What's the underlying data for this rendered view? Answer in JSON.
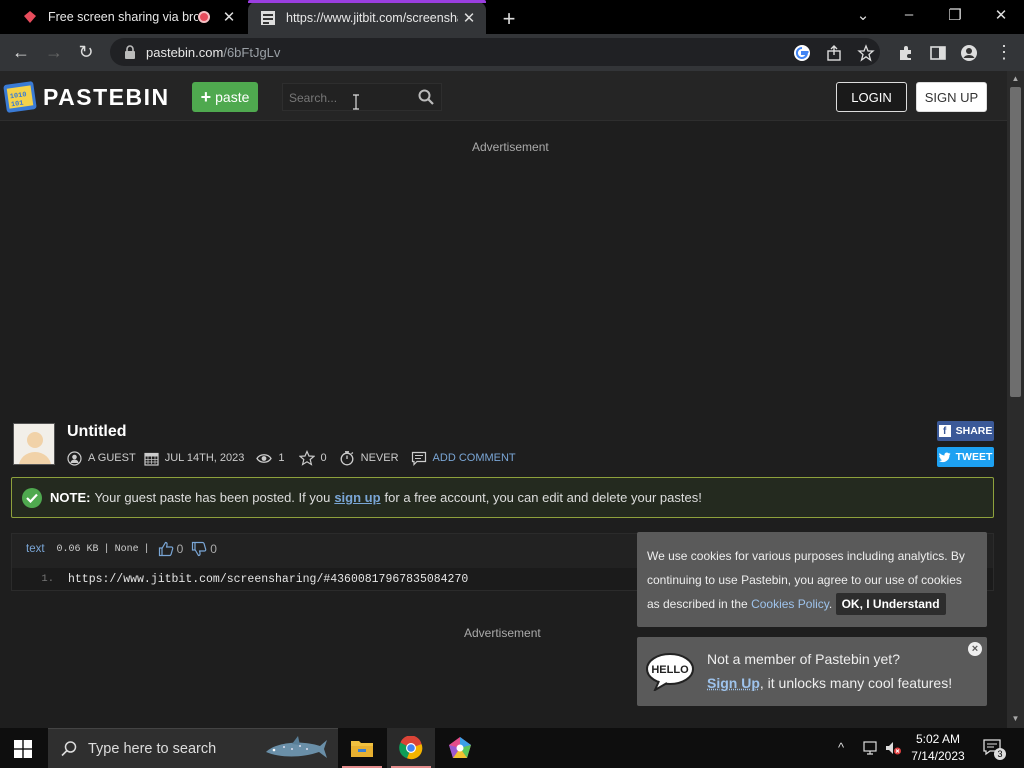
{
  "browser": {
    "tabs": [
      {
        "title": "Free screen sharing via brow",
        "recording": true
      },
      {
        "title": "https://www.jitbit.com/screensha",
        "active": true
      }
    ],
    "url_host": "pastebin.com",
    "url_path": "/6bFtJgLv"
  },
  "header": {
    "brand": "PASTEBIN",
    "paste_button": "paste",
    "search_placeholder": "Search...",
    "login": "LOGIN",
    "signup": "SIGN UP"
  },
  "ads": {
    "top_label": "Advertisement",
    "bottom_label": "Advertisement"
  },
  "paste": {
    "title": "Untitled",
    "author": "A GUEST",
    "date": "JUL 14TH, 2023",
    "views": "1",
    "stars": "0",
    "expiry": "NEVER",
    "add_comment": "ADD COMMENT",
    "share": "SHARE",
    "tweet": "TWEET"
  },
  "notice": {
    "label": "NOTE:",
    "text_before": "Your guest paste has been posted. If you",
    "link": "sign up",
    "text_after": "for a free account, you can edit and delete your pastes!"
  },
  "code": {
    "language": "text",
    "size": "0.06 KB",
    "sep": "|",
    "category": "None",
    "sep2": "|",
    "likes": "0",
    "dislikes": "0",
    "lines": [
      {
        "num": "1.",
        "text": "https://www.jitbit.com/screensharing/#43600817967835084270"
      }
    ]
  },
  "cookie": {
    "text": "We use cookies for various purposes including analytics. By continuing to use Pastebin, you agree to our use of cookies as described in the",
    "policy_link": "Cookies Policy",
    "period": ".",
    "ok": "OK, I Understand"
  },
  "member": {
    "line1": "Not a member of Pastebin yet?",
    "signup_link": "Sign Up",
    "line2_rest": ", it unlocks many cool features!",
    "close": "×"
  },
  "taskbar": {
    "search_placeholder": "Type here to search",
    "time": "5:02 AM",
    "date": "7/14/2023",
    "notifications": "3"
  },
  "colors": {
    "accent_green": "#4fa94f",
    "link_blue": "#7aa6d6",
    "notice_border": "#8ea13c",
    "facebook": "#3b5998",
    "twitter": "#1da1f2"
  }
}
